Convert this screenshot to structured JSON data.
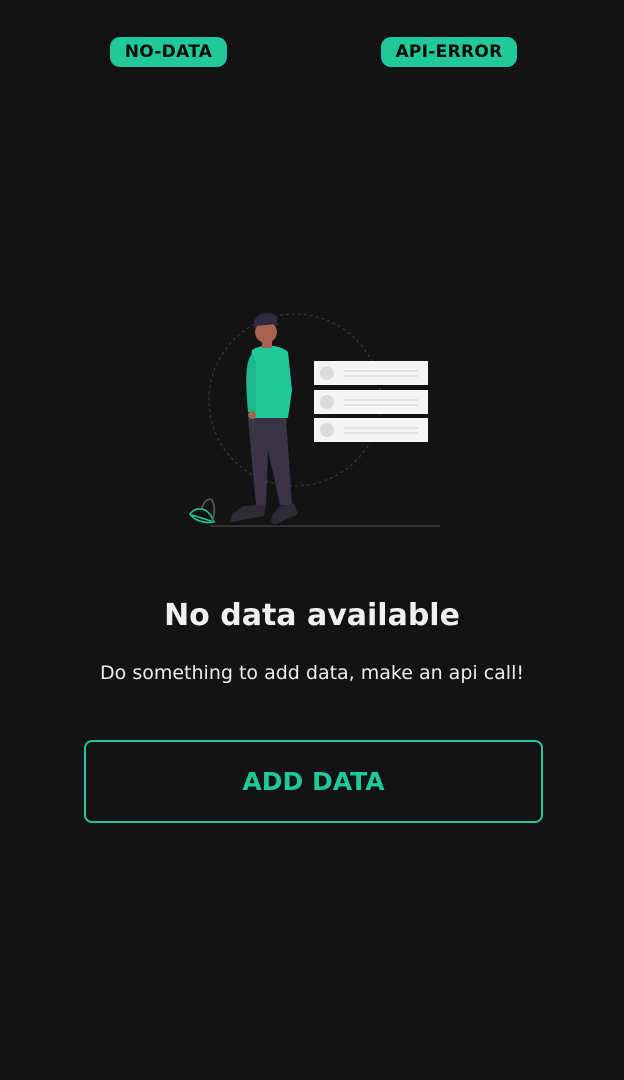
{
  "top_buttons": {
    "no_data_label": "NO-DATA",
    "api_error_label": "API-ERROR"
  },
  "empty_state": {
    "title": "No data available",
    "subtitle": "Do something to add data, make an api call!",
    "action_label": "ADD DATA"
  },
  "colors": {
    "background": "#131313",
    "accent": "#20c997",
    "text": "#f0f0f0"
  },
  "icons": {
    "illustration": "person-with-list-illustration"
  }
}
